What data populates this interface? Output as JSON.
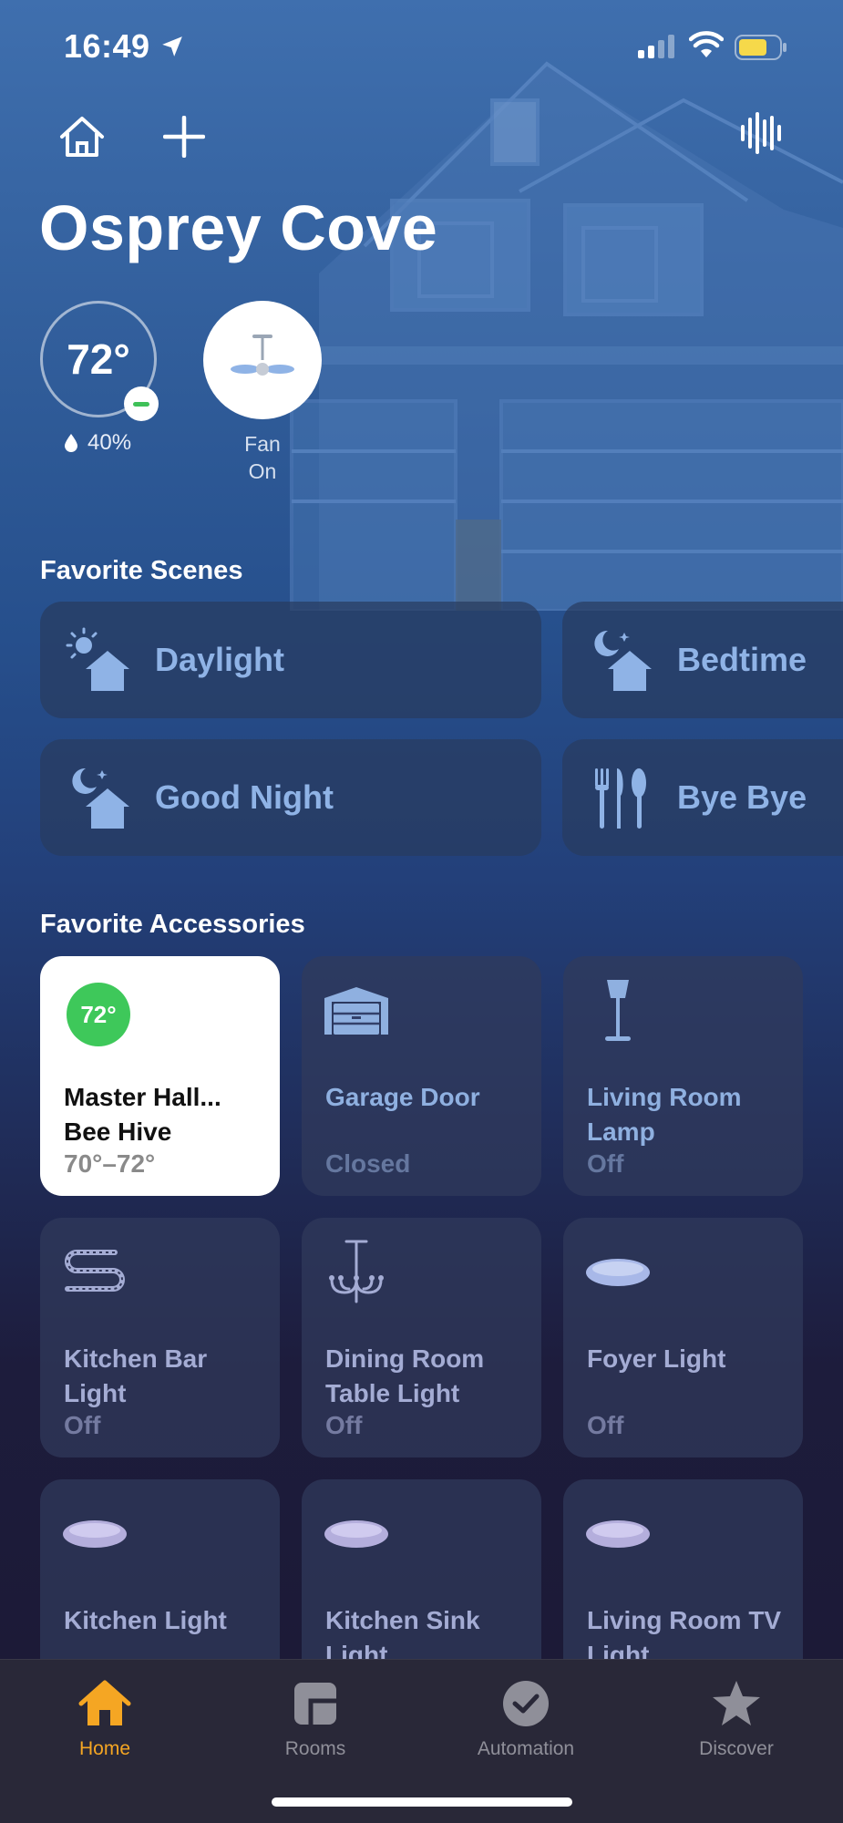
{
  "status_bar": {
    "time": "16:49"
  },
  "header": {
    "title": "Osprey Cove"
  },
  "climate": {
    "temperature": "72°",
    "humidity": "40%"
  },
  "fan": {
    "name": "Fan",
    "state": "On"
  },
  "scenes": {
    "title": "Favorite Scenes",
    "items": [
      {
        "label": "Daylight",
        "icon": "sun-house-icon"
      },
      {
        "label": "Bedtime",
        "icon": "moon-house-icon"
      },
      {
        "label": "Good Night",
        "icon": "moon-house-icon"
      },
      {
        "label": "Bye Bye",
        "icon": "utensils-icon"
      }
    ]
  },
  "accessories": {
    "title": "Favorite Accessories",
    "items": [
      {
        "badge": "72°",
        "name": "Master Hall... Bee Hive",
        "state": "70°–72°"
      },
      {
        "name": "Garage Door",
        "state": "Closed"
      },
      {
        "name": "Living Room Lamp",
        "state": "Off"
      },
      {
        "name": "Kitchen Bar Light",
        "state": "Off"
      },
      {
        "name": "Dining Room Table Light",
        "state": "Off"
      },
      {
        "name": "Foyer Light",
        "state": "Off"
      },
      {
        "name": "Kitchen Light",
        "state": ""
      },
      {
        "name": "Kitchen Sink Light",
        "state": ""
      },
      {
        "name": "Living Room TV Light",
        "state": ""
      }
    ]
  },
  "tabs": [
    {
      "label": "Home",
      "selected": true
    },
    {
      "label": "Rooms"
    },
    {
      "label": "Automation"
    },
    {
      "label": "Discover"
    }
  ],
  "colors": {
    "accent": "#f5a623",
    "thermostat_green": "#3ec85a",
    "scene_text": "#8fb3e6"
  }
}
